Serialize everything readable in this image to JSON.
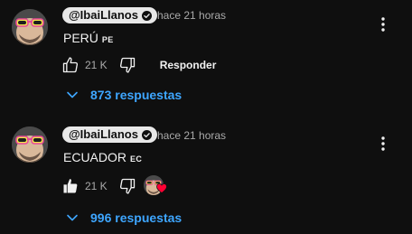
{
  "colors": {
    "background": "#0f0f0f",
    "text": "#f1f1f1",
    "muted": "#aaaaaa",
    "link": "#3ea6ff",
    "chip": "#e8e8e8",
    "heart": "#ff0033"
  },
  "comments": [
    {
      "author": "@IbaiLlanos",
      "timestamp": "hace 21 horas",
      "text": "PERÚ",
      "country_code": "PE",
      "like_count": "21 K",
      "liked": false,
      "reply_label": "Responder",
      "creator_heart": false,
      "replies_label": "873 respuestas",
      "icons": [
        "avatar",
        "verified-icon",
        "thumbs-up-icon",
        "thumbs-down-icon",
        "more-vert-icon",
        "chevron-down-icon"
      ]
    },
    {
      "author": "@IbaiLlanos",
      "timestamp": "hace 21 horas",
      "text": "ECUADOR",
      "country_code": "EC",
      "like_count": "21 K",
      "liked": true,
      "creator_heart": true,
      "replies_label": "996 respuestas",
      "icons": [
        "avatar",
        "verified-icon",
        "thumbs-up-filled-icon",
        "thumbs-down-icon",
        "creator-heart-icon",
        "more-vert-icon",
        "chevron-down-icon"
      ]
    }
  ]
}
